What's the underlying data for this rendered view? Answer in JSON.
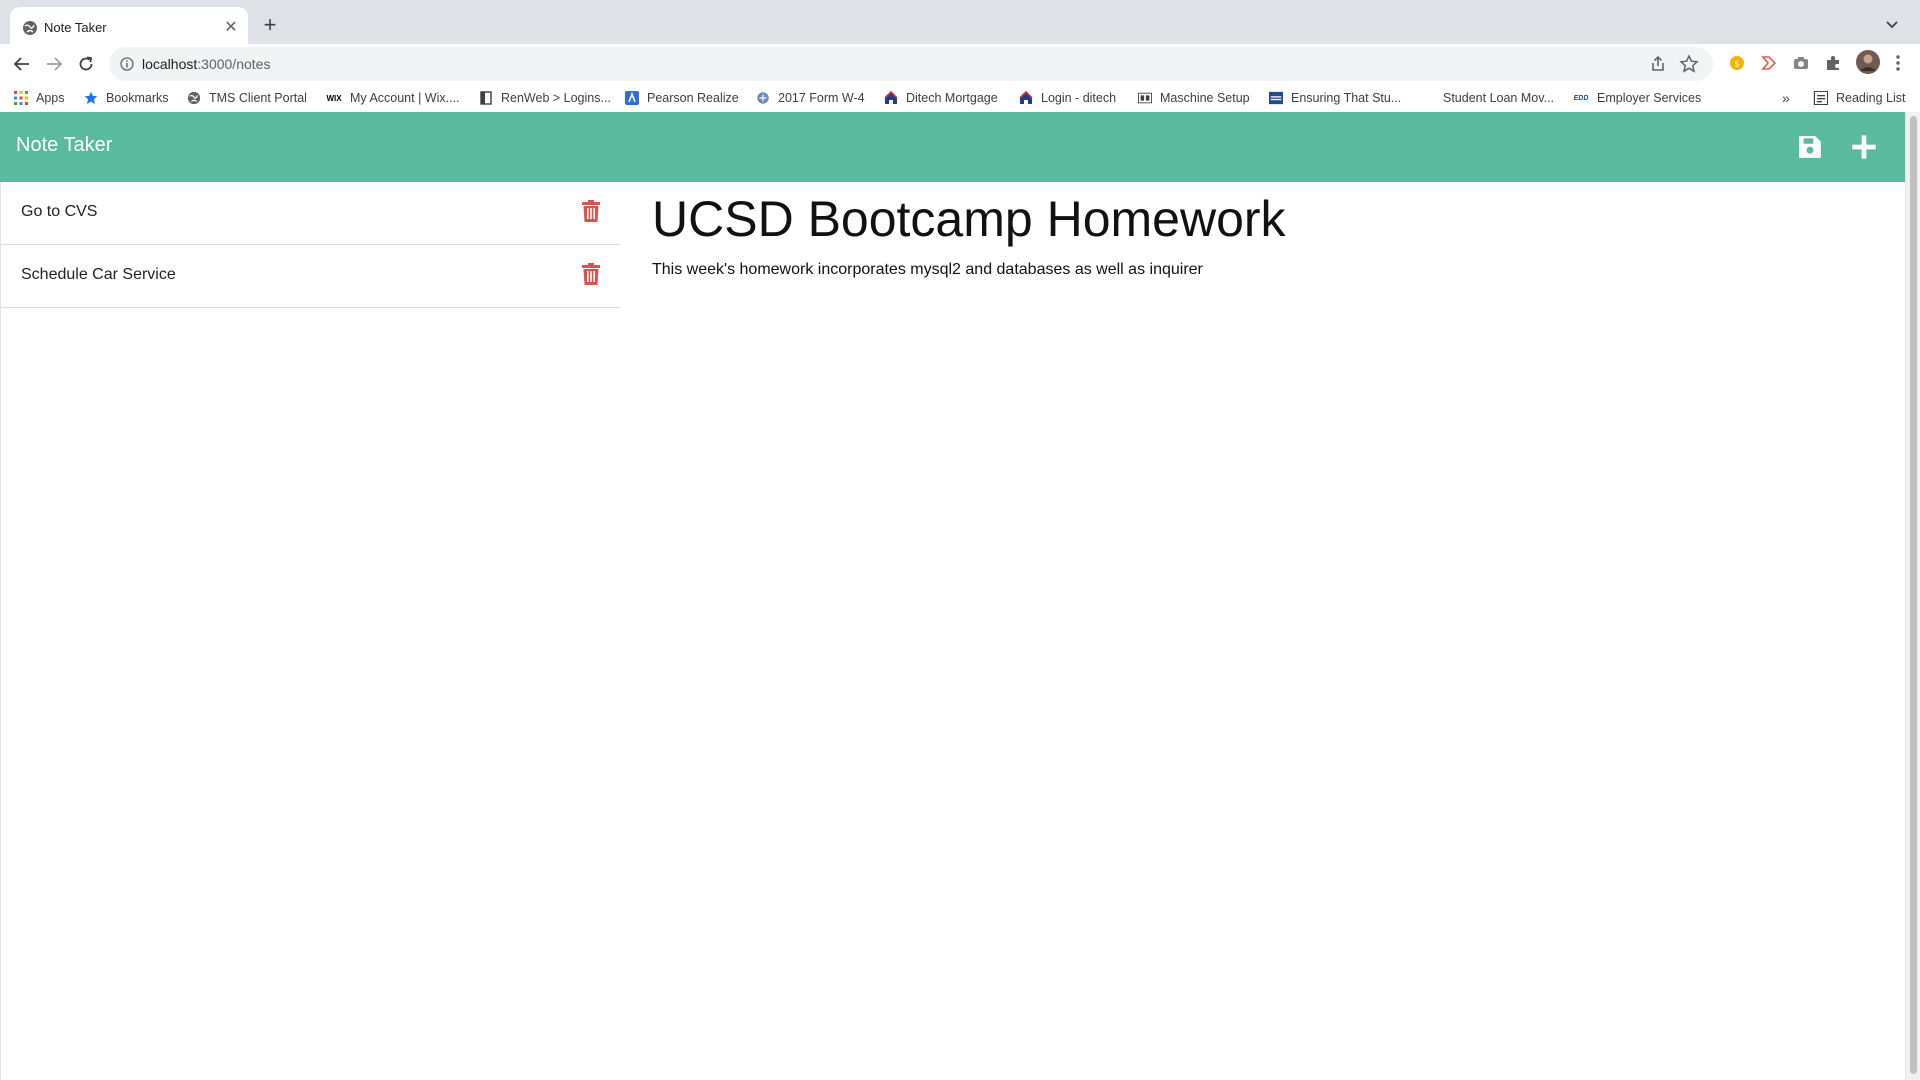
{
  "browser": {
    "tab": {
      "title": "Note Taker",
      "close_glyph": "✕",
      "icon": "globe-icon"
    },
    "new_tab_glyph": "+",
    "url": {
      "host": "localhost",
      "path": ":3000/notes"
    },
    "bookmarks": [
      {
        "label": "Apps",
        "icon": "apps-grid-icon"
      },
      {
        "label": "Bookmarks",
        "icon": "star-icon"
      },
      {
        "label": "TMS Client Portal",
        "icon": "globe-icon"
      },
      {
        "label": "My Account | Wix....",
        "icon": "wix-icon",
        "icon_text": "WIX"
      },
      {
        "label": "RenWeb > Logins...",
        "icon": "page-icon"
      },
      {
        "label": "Pearson Realize",
        "icon": "pearson-icon"
      },
      {
        "label": "2017 Form W-4",
        "icon": "irs-icon"
      },
      {
        "label": "Ditech Mortgage",
        "icon": "house-icon"
      },
      {
        "label": "Login - ditech",
        "icon": "house-icon"
      },
      {
        "label": "Maschine Setup",
        "icon": "maschine-icon"
      },
      {
        "label": "Ensuring That Stu...",
        "icon": "doc-icon"
      },
      {
        "label": "Student Loan Mov...",
        "icon": "blank-icon"
      },
      {
        "label": "Employer Services",
        "icon": "edd-icon",
        "icon_text": "EDD"
      }
    ],
    "overflow_glyph": "»",
    "reading_list": "Reading List"
  },
  "app": {
    "title": "Note Taker",
    "notes": [
      {
        "title": "Go to CVS"
      },
      {
        "title": "Schedule Car Service"
      }
    ],
    "active_note": {
      "title": "UCSD Bootcamp Homework",
      "text": "This week's homework incorporates mysql2 and databases as well as inquirer"
    }
  },
  "colors": {
    "header": "#5aba9d",
    "trash": "#d9534f",
    "tab_strip": "#dee1e6"
  }
}
